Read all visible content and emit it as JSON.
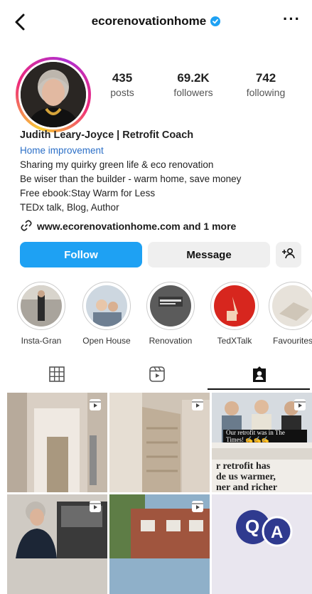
{
  "header": {
    "username": "ecorenovationhome",
    "back_icon": "chevron-left-icon",
    "verified_icon": "verified-badge-icon",
    "more_label": "···"
  },
  "stats": [
    {
      "value": "435",
      "label": "posts"
    },
    {
      "value": "69.2K",
      "label": "followers"
    },
    {
      "value": "742",
      "label": "following"
    }
  ],
  "bio": {
    "name": "Judith Leary-Joyce | Retrofit Coach",
    "category": "Home improvement",
    "lines": [
      "Sharing my quirky green life & eco renovation",
      "Be wiser than the builder - warm home, save money",
      "Free ebook:Stay Warm for Less",
      "TEDx talk, Blog, Author"
    ],
    "link": "www.ecorenovationhome.com and 1 more"
  },
  "actions": {
    "follow": "Follow",
    "message": "Message"
  },
  "highlights": [
    {
      "label": "Insta-Gran"
    },
    {
      "label": "Open House"
    },
    {
      "label": "Renovation"
    },
    {
      "label": "TedXTalk"
    },
    {
      "label": "Favourites"
    }
  ],
  "tabs": [
    "grid-icon",
    "reels-icon",
    "tagged-icon"
  ],
  "posts": {
    "caption_3": "Our retrofit was in The Times! ✍✍✍",
    "text_6_line1": "r retrofit has",
    "text_6_line2": "de us warmer,",
    "text_6_line3": "ner and richer",
    "qa_q": "Q",
    "qa_a": "A"
  },
  "colors": {
    "follow_button": "#1ea1f3",
    "category_link": "#2b6fc7",
    "verified": "#1ea1f3"
  }
}
